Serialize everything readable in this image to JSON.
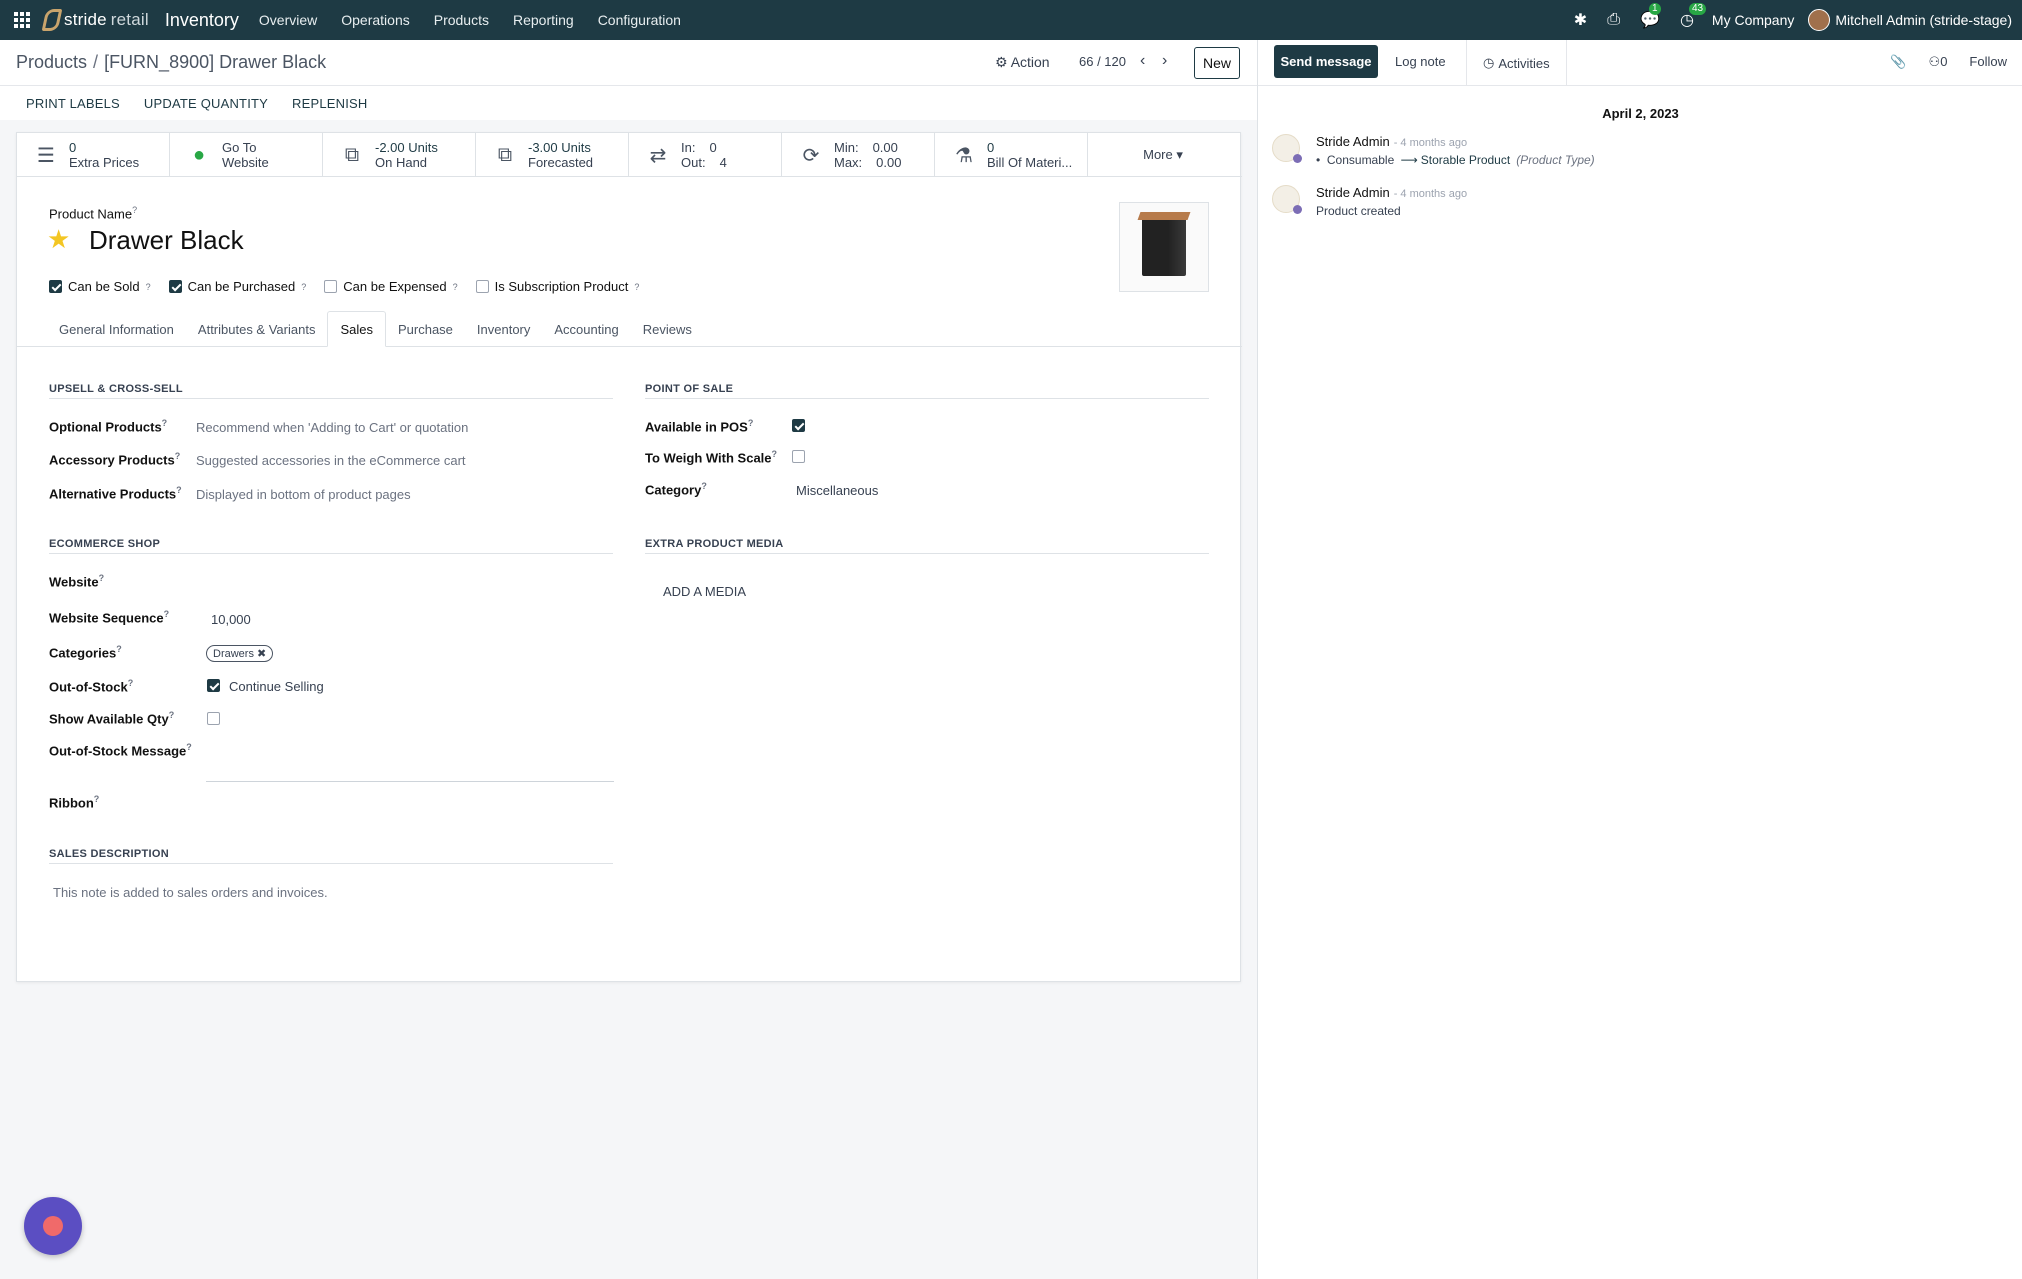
{
  "navbar": {
    "brand_main": "stride",
    "brand_sub": "retail",
    "app": "Inventory",
    "menu": [
      "Overview",
      "Operations",
      "Products",
      "Reporting",
      "Configuration"
    ],
    "chat_count": "1",
    "activity_count": "43",
    "company": "My Company",
    "user": "Mitchell Admin (stride-stage)"
  },
  "control": {
    "breadcrumb_parent": "Products",
    "breadcrumb_sep": "/",
    "breadcrumb_current": "[FURN_8900] Drawer Black",
    "action_label": "Action",
    "pager": "66 / 120",
    "new_label": "New"
  },
  "action_buttons": [
    "PRINT LABELS",
    "UPDATE QUANTITY",
    "REPLENISH"
  ],
  "smart_buttons": {
    "extra_prices": {
      "value": "0",
      "label": "Extra Prices"
    },
    "website": {
      "line1": "Go To",
      "line2": "Website"
    },
    "on_hand": {
      "value": "-2.00 Units",
      "label": "On Hand"
    },
    "forecasted": {
      "value": "-3.00 Units",
      "label": "Forecasted"
    },
    "in_out": {
      "in_label": "In:",
      "in_value": "0",
      "out_label": "Out:",
      "out_value": "4"
    },
    "min_max": {
      "min_label": "Min:",
      "min_value": "0.00",
      "max_label": "Max:",
      "max_value": "0.00"
    },
    "bom": {
      "value": "0",
      "label": "Bill Of Materi..."
    },
    "more": "More"
  },
  "product": {
    "name_label": "Product Name",
    "name": "Drawer Black",
    "can_be_sold": "Can be Sold",
    "can_be_purchased": "Can be Purchased",
    "can_be_expensed": "Can be Expensed",
    "is_subscription": "Is Subscription Product"
  },
  "tabs": [
    "General Information",
    "Attributes & Variants",
    "Sales",
    "Purchase",
    "Inventory",
    "Accounting",
    "Reviews"
  ],
  "sales": {
    "upsell_title": "UPSELL & CROSS-SELL",
    "optional_label": "Optional Products",
    "optional_placeholder": "Recommend when 'Adding to Cart' or quotation",
    "accessory_label": "Accessory Products",
    "accessory_placeholder": "Suggested accessories in the eCommerce cart",
    "alternative_label": "Alternative Products",
    "alternative_placeholder": "Displayed in bottom of product pages",
    "pos_title": "POINT OF SALE",
    "available_pos_label": "Available in POS",
    "weigh_label": "To Weigh With Scale",
    "category_label": "Category",
    "category_value": "Miscellaneous",
    "ecommerce_title": "ECOMMERCE SHOP",
    "website_label": "Website",
    "website_seq_label": "Website Sequence",
    "website_seq_value": "10,000",
    "categories_label": "Categories",
    "categories_tag": "Drawers",
    "oos_label": "Out-of-Stock",
    "continue_selling": "Continue Selling",
    "show_qty_label": "Show Available Qty",
    "oos_msg_label": "Out-of-Stock Message",
    "ribbon_label": "Ribbon",
    "media_title": "EXTRA PRODUCT MEDIA",
    "add_media": "ADD A MEDIA",
    "desc_title": "SALES DESCRIPTION",
    "desc_placeholder": "This note is added to sales orders and invoices."
  },
  "chatter": {
    "send_message": "Send message",
    "log_note": "Log note",
    "activities": "Activities",
    "followers": "0",
    "follow": "Follow",
    "date": "April 2, 2023",
    "messages": [
      {
        "author": "Stride Admin",
        "ago": "- 4 months ago",
        "old": "Consumable",
        "new": "Storable Product",
        "field": "(Product Type)"
      },
      {
        "author": "Stride Admin",
        "ago": "- 4 months ago",
        "text": "Product created"
      }
    ]
  }
}
